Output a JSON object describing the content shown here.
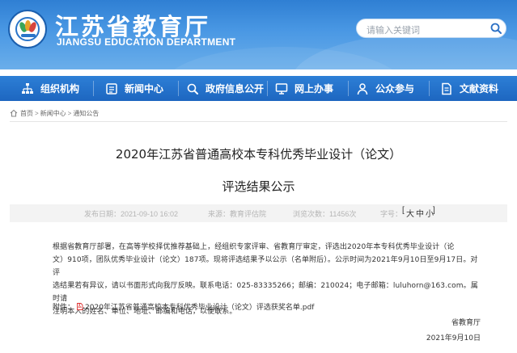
{
  "header": {
    "title": "江苏省教育厅",
    "subtitle": "JIANGSU EDUCATION DEPARTMENT",
    "search_placeholder": "请输入关键词"
  },
  "nav": {
    "items": [
      {
        "label": "组织机构",
        "icon": "org-chart-icon"
      },
      {
        "label": "新闻中心",
        "icon": "news-icon"
      },
      {
        "label": "政府信息公开",
        "icon": "info-disclosure-icon"
      },
      {
        "label": "网上办事",
        "icon": "online-service-icon"
      },
      {
        "label": "公众参与",
        "icon": "people-icon"
      },
      {
        "label": "文献资料",
        "icon": "document-icon"
      }
    ]
  },
  "breadcrumb": {
    "items": [
      "首页",
      "新闻中心",
      "通知公告"
    ],
    "separator": ">"
  },
  "article": {
    "title_line1": "2020年江苏省普通高校本专科优秀毕业设计（论文）",
    "title_line2": "评选结果公示",
    "meta": {
      "published": "发布日期：2021-09-10 16:02",
      "source": "来源：教育评估院",
      "views": "浏览次数：11456次",
      "font_size_label": "字号：",
      "font_sizes": [
        "大",
        "中",
        "小"
      ],
      "bracket_open": "[",
      "bracket_close": "]"
    },
    "body_lines": [
      "根据省教育厅部署，在高等学校择优推荐基础上，经组织专家评审、省教育厅审定，评选出2020年本专科优秀毕业设计（论",
      "文）910项，团队优秀毕业设计（论文）187项。现将评选结果予以公示（名单附后）。公示时间为2021年9月10日至9月17日。对评",
      "选结果若有异议，请以书面形式向我厅反映。联系电话：025-83335266；邮编：210024；电子邮箱：luluhorn@163.com。属时请",
      "注明本人的姓名、单位、地址、邮编和电话，以便联系。"
    ],
    "attachment_label": "附件：",
    "attachment_name": "2020年江苏省普通高校本专科优秀毕业设计（论文）评选获奖名单.pdf",
    "signature": "省教育厅",
    "date": "2021年9月10日"
  },
  "colors": {
    "header_blue": "#3b8be0",
    "nav_blue": "#2572cc",
    "meta_bg": "#f3f3f3"
  }
}
